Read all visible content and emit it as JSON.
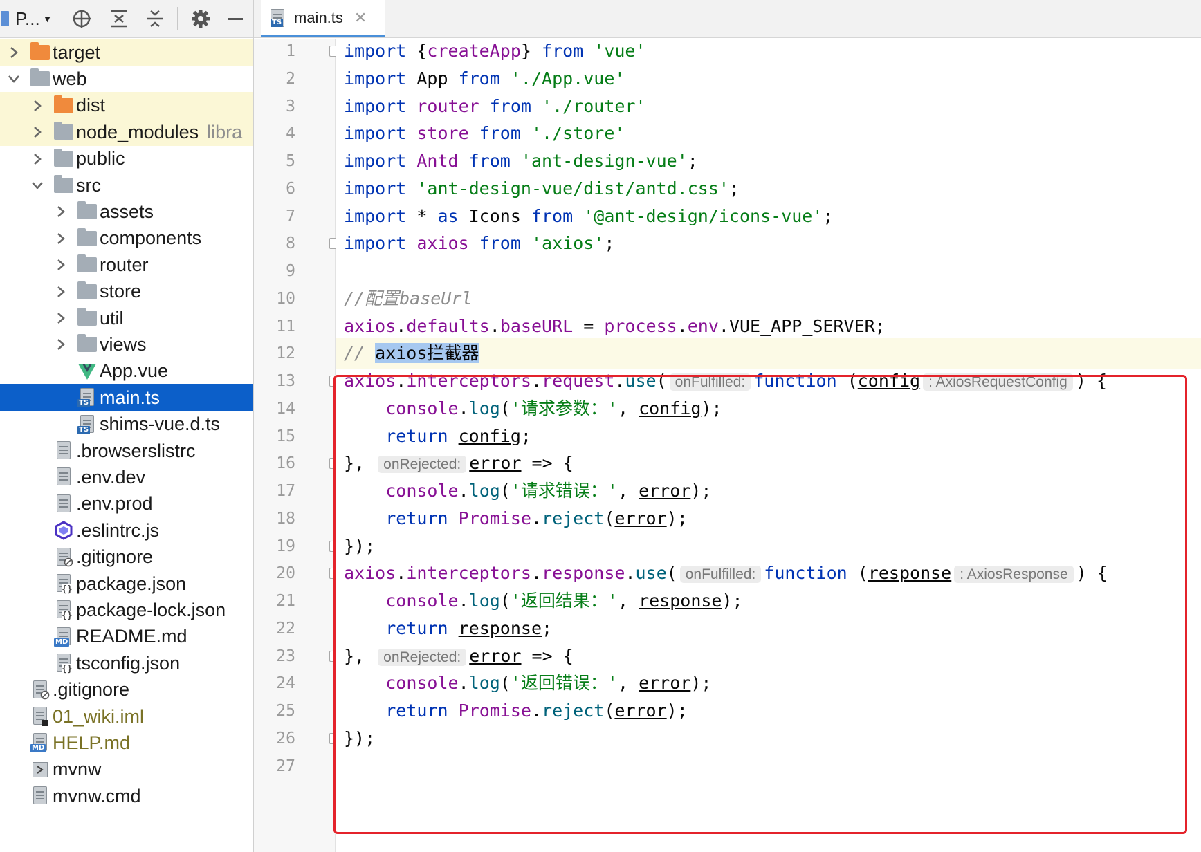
{
  "panel": {
    "title": "P...",
    "tree": [
      {
        "label": "target",
        "type": "folder",
        "color": "orange",
        "indent": 0,
        "chevron": "right",
        "style": "hl"
      },
      {
        "label": "web",
        "type": "folder",
        "color": "gray",
        "indent": 0,
        "chevron": "down",
        "style": ""
      },
      {
        "label": "dist",
        "type": "folder",
        "color": "orange",
        "indent": 1,
        "chevron": "right",
        "style": "hl"
      },
      {
        "label": "node_modules",
        "extra": "libra",
        "type": "folder",
        "color": "gray",
        "indent": 1,
        "chevron": "right",
        "style": "hl"
      },
      {
        "label": "public",
        "type": "folder",
        "color": "gray",
        "indent": 1,
        "chevron": "right",
        "style": ""
      },
      {
        "label": "src",
        "type": "folder",
        "color": "gray",
        "indent": 1,
        "chevron": "down",
        "style": ""
      },
      {
        "label": "assets",
        "type": "folder",
        "color": "gray",
        "indent": 2,
        "chevron": "right",
        "style": ""
      },
      {
        "label": "components",
        "type": "folder",
        "color": "gray",
        "indent": 2,
        "chevron": "right",
        "style": ""
      },
      {
        "label": "router",
        "type": "folder",
        "color": "gray",
        "indent": 2,
        "chevron": "right",
        "style": ""
      },
      {
        "label": "store",
        "type": "folder",
        "color": "gray",
        "indent": 2,
        "chevron": "right",
        "style": ""
      },
      {
        "label": "util",
        "type": "folder",
        "color": "gray",
        "indent": 2,
        "chevron": "right",
        "style": ""
      },
      {
        "label": "views",
        "type": "folder",
        "color": "gray",
        "indent": 2,
        "chevron": "right",
        "style": ""
      },
      {
        "label": "App.vue",
        "type": "vue",
        "indent": 2,
        "chevron": "",
        "style": ""
      },
      {
        "label": "main.ts",
        "type": "ts",
        "indent": 2,
        "chevron": "",
        "style": "sel"
      },
      {
        "label": "shims-vue.d.ts",
        "type": "ts",
        "indent": 2,
        "chevron": "",
        "style": ""
      },
      {
        "label": ".browserslistrc",
        "type": "file",
        "indent": 1,
        "chevron": "",
        "style": ""
      },
      {
        "label": ".env.dev",
        "type": "file",
        "indent": 1,
        "chevron": "",
        "style": ""
      },
      {
        "label": ".env.prod",
        "type": "file",
        "indent": 1,
        "chevron": "",
        "style": ""
      },
      {
        "label": ".eslintrc.js",
        "type": "eslint",
        "indent": 1,
        "chevron": "",
        "style": ""
      },
      {
        "label": ".gitignore",
        "type": "gitignore",
        "indent": 1,
        "chevron": "",
        "style": ""
      },
      {
        "label": "package.json",
        "type": "json",
        "indent": 1,
        "chevron": "",
        "style": ""
      },
      {
        "label": "package-lock.json",
        "type": "json",
        "indent": 1,
        "chevron": "",
        "style": ""
      },
      {
        "label": "README.md",
        "type": "md",
        "indent": 1,
        "chevron": "",
        "style": ""
      },
      {
        "label": "tsconfig.json",
        "type": "json",
        "indent": 1,
        "chevron": "",
        "style": ""
      },
      {
        "label": ".gitignore",
        "type": "gitignore",
        "indent": 0,
        "chevron": "",
        "style": ""
      },
      {
        "label": "01_wiki.iml",
        "type": "iml",
        "indent": 0,
        "chevron": "",
        "style": "olive"
      },
      {
        "label": "HELP.md",
        "type": "md",
        "indent": 0,
        "chevron": "",
        "style": "olive"
      },
      {
        "label": "mvnw",
        "type": "exec",
        "indent": 0,
        "chevron": "",
        "style": ""
      },
      {
        "label": "mvnw.cmd",
        "type": "file",
        "indent": 0,
        "chevron": "",
        "style": ""
      }
    ]
  },
  "editor": {
    "tab": {
      "label": "main.ts",
      "badge": "TS"
    },
    "current_line": 12,
    "lines": [
      [
        [
          "kw",
          "import"
        ],
        [
          "p",
          " {"
        ],
        [
          "id",
          "createApp"
        ],
        [
          "p",
          "} "
        ],
        [
          "kw",
          "from"
        ],
        [
          "p",
          " "
        ],
        [
          "str",
          "'vue'"
        ]
      ],
      [
        [
          "kw",
          "import"
        ],
        [
          "p",
          " App "
        ],
        [
          "kw",
          "from"
        ],
        [
          "p",
          " "
        ],
        [
          "str",
          "'./App.vue'"
        ]
      ],
      [
        [
          "kw",
          "import"
        ],
        [
          "p",
          " "
        ],
        [
          "id",
          "router"
        ],
        [
          "p",
          " "
        ],
        [
          "kw",
          "from"
        ],
        [
          "p",
          " "
        ],
        [
          "str",
          "'./router'"
        ]
      ],
      [
        [
          "kw",
          "import"
        ],
        [
          "p",
          " "
        ],
        [
          "id",
          "store"
        ],
        [
          "p",
          " "
        ],
        [
          "kw",
          "from"
        ],
        [
          "p",
          " "
        ],
        [
          "str",
          "'./store'"
        ]
      ],
      [
        [
          "kw",
          "import"
        ],
        [
          "p",
          " "
        ],
        [
          "id",
          "Antd"
        ],
        [
          "p",
          " "
        ],
        [
          "kw",
          "from"
        ],
        [
          "p",
          " "
        ],
        [
          "str",
          "'ant-design-vue'"
        ],
        [
          "p",
          ";"
        ]
      ],
      [
        [
          "kw",
          "import"
        ],
        [
          "p",
          " "
        ],
        [
          "str",
          "'ant-design-vue/dist/antd.css'"
        ],
        [
          "p",
          ";"
        ]
      ],
      [
        [
          "kw",
          "import"
        ],
        [
          "p",
          " * "
        ],
        [
          "kw",
          "as"
        ],
        [
          "p",
          " Icons "
        ],
        [
          "kw",
          "from"
        ],
        [
          "p",
          " "
        ],
        [
          "str",
          "'@ant-design/icons-vue'"
        ],
        [
          "p",
          ";"
        ]
      ],
      [
        [
          "kw",
          "import"
        ],
        [
          "p",
          " "
        ],
        [
          "id",
          "axios"
        ],
        [
          "p",
          " "
        ],
        [
          "kw",
          "from"
        ],
        [
          "p",
          " "
        ],
        [
          "str",
          "'axios'"
        ],
        [
          "p",
          ";"
        ]
      ],
      [],
      [
        [
          "cm",
          "//配置baseUrl"
        ]
      ],
      [
        [
          "id",
          "axios"
        ],
        [
          "p",
          "."
        ],
        [
          "id",
          "defaults"
        ],
        [
          "p",
          "."
        ],
        [
          "id",
          "baseURL"
        ],
        [
          "p",
          " = "
        ],
        [
          "id",
          "process"
        ],
        [
          "p",
          "."
        ],
        [
          "id",
          "env"
        ],
        [
          "p",
          ".VUE_APP_SERVER;"
        ]
      ],
      [
        [
          "cm",
          "// "
        ],
        [
          "cmsel",
          "axios拦截器"
        ]
      ],
      [
        [
          "id",
          "axios"
        ],
        [
          "p",
          "."
        ],
        [
          "id",
          "interceptors"
        ],
        [
          "p",
          "."
        ],
        [
          "id",
          "request"
        ],
        [
          "p",
          "."
        ],
        [
          "mt",
          "use"
        ],
        [
          "p",
          "("
        ],
        [
          "hint",
          "onFulfilled:"
        ],
        [
          "kw",
          "function"
        ],
        [
          "p",
          " ("
        ],
        [
          "ul",
          "config"
        ],
        [
          "hint",
          ": AxiosRequestConfig"
        ],
        [
          "p",
          ") {"
        ]
      ],
      [
        [
          "p",
          "    "
        ],
        [
          "id",
          "console"
        ],
        [
          "p",
          "."
        ],
        [
          "mt",
          "log"
        ],
        [
          "p",
          "("
        ],
        [
          "str",
          "'请求参数：'"
        ],
        [
          "p",
          ", "
        ],
        [
          "ul",
          "config"
        ],
        [
          "p",
          ");"
        ]
      ],
      [
        [
          "p",
          "    "
        ],
        [
          "kw",
          "return"
        ],
        [
          "p",
          " "
        ],
        [
          "ul",
          "config"
        ],
        [
          "p",
          ";"
        ]
      ],
      [
        [
          "p",
          "}, "
        ],
        [
          "hint",
          "onRejected:"
        ],
        [
          "ul",
          "error"
        ],
        [
          "p",
          " => {"
        ]
      ],
      [
        [
          "p",
          "    "
        ],
        [
          "id",
          "console"
        ],
        [
          "p",
          "."
        ],
        [
          "mt",
          "log"
        ],
        [
          "p",
          "("
        ],
        [
          "str",
          "'请求错误：'"
        ],
        [
          "p",
          ", "
        ],
        [
          "ul",
          "error"
        ],
        [
          "p",
          ");"
        ]
      ],
      [
        [
          "p",
          "    "
        ],
        [
          "kw",
          "return"
        ],
        [
          "p",
          " "
        ],
        [
          "id",
          "Promise"
        ],
        [
          "p",
          "."
        ],
        [
          "mt",
          "reject"
        ],
        [
          "p",
          "("
        ],
        [
          "ul",
          "error"
        ],
        [
          "p",
          ");"
        ]
      ],
      [
        [
          "p",
          "});"
        ]
      ],
      [
        [
          "id",
          "axios"
        ],
        [
          "p",
          "."
        ],
        [
          "id",
          "interceptors"
        ],
        [
          "p",
          "."
        ],
        [
          "id",
          "response"
        ],
        [
          "p",
          "."
        ],
        [
          "mt",
          "use"
        ],
        [
          "p",
          "("
        ],
        [
          "hint",
          "onFulfilled:"
        ],
        [
          "kw",
          "function"
        ],
        [
          "p",
          " ("
        ],
        [
          "ul",
          "response"
        ],
        [
          "hint",
          ": AxiosResponse"
        ],
        [
          "p",
          ") {"
        ]
      ],
      [
        [
          "p",
          "    "
        ],
        [
          "id",
          "console"
        ],
        [
          "p",
          "."
        ],
        [
          "mt",
          "log"
        ],
        [
          "p",
          "("
        ],
        [
          "str",
          "'返回结果：'"
        ],
        [
          "p",
          ", "
        ],
        [
          "ul",
          "response"
        ],
        [
          "p",
          ");"
        ]
      ],
      [
        [
          "p",
          "    "
        ],
        [
          "kw",
          "return"
        ],
        [
          "p",
          " "
        ],
        [
          "ul",
          "response"
        ],
        [
          "p",
          ";"
        ]
      ],
      [
        [
          "p",
          "}, "
        ],
        [
          "hint",
          "onRejected:"
        ],
        [
          "ul",
          "error"
        ],
        [
          "p",
          " => {"
        ]
      ],
      [
        [
          "p",
          "    "
        ],
        [
          "id",
          "console"
        ],
        [
          "p",
          "."
        ],
        [
          "mt",
          "log"
        ],
        [
          "p",
          "("
        ],
        [
          "str",
          "'返回错误：'"
        ],
        [
          "p",
          ", "
        ],
        [
          "ul",
          "error"
        ],
        [
          "p",
          ");"
        ]
      ],
      [
        [
          "p",
          "    "
        ],
        [
          "kw",
          "return"
        ],
        [
          "p",
          " "
        ],
        [
          "id",
          "Promise"
        ],
        [
          "p",
          "."
        ],
        [
          "mt",
          "reject"
        ],
        [
          "p",
          "("
        ],
        [
          "ul",
          "error"
        ],
        [
          "p",
          ");"
        ]
      ],
      [
        [
          "p",
          "});"
        ]
      ],
      []
    ],
    "line_numbers": [
      "1",
      "2",
      "3",
      "4",
      "5",
      "6",
      "7",
      "8",
      "9",
      "10",
      "11",
      "12",
      "13",
      "14",
      "15",
      "16",
      "17",
      "18",
      "19",
      "20",
      "21",
      "22",
      "23",
      "24",
      "25",
      "26",
      "27"
    ],
    "fold_lines": [
      1,
      8,
      13,
      16,
      19,
      20,
      23,
      26
    ]
  },
  "colors": {
    "selection": "#0c5fc9",
    "keyword": "#0033b3",
    "string": "#067d17",
    "identifier": "#871094",
    "annotation_box": "#e4232b"
  }
}
